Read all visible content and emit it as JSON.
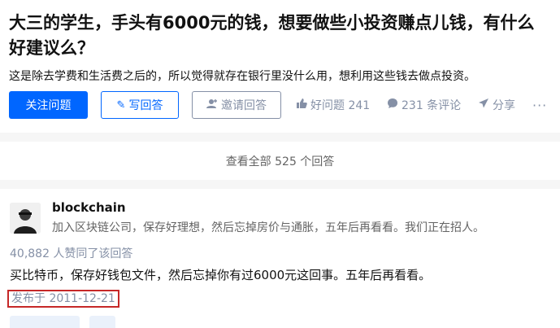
{
  "question": {
    "title": "大三的学生，手头有6000元的钱，想要做些小投资赚点儿钱，有什么好建议么？",
    "detail": "这是除去学费和生活费之后的，所以觉得就存在银行里没什么用，想利用这些钱去做点投资。"
  },
  "actions": {
    "follow_label": "关注问题",
    "write_label": "写回答",
    "invite_label": "邀请回答",
    "good_question": "好问题 241",
    "comments": "231 条评论",
    "share": "分享",
    "more": "···"
  },
  "view_all": "查看全部 525 个回答",
  "answer": {
    "author": "blockchain",
    "bio": "加入区块链公司，保存好理想，然后忘掉房价与通胀，五年后再看看。我们正在招人。",
    "voters": "40,882 人赞同了该回答",
    "content": "买比特币，保存好钱包文件，然后忘掉你有过6000元这回事。五年后再看看。",
    "published": "发布于 2011-12-21"
  },
  "colors": {
    "primary": "#0066ff",
    "muted": "#8590a6",
    "highlight_border": "#c62828"
  }
}
